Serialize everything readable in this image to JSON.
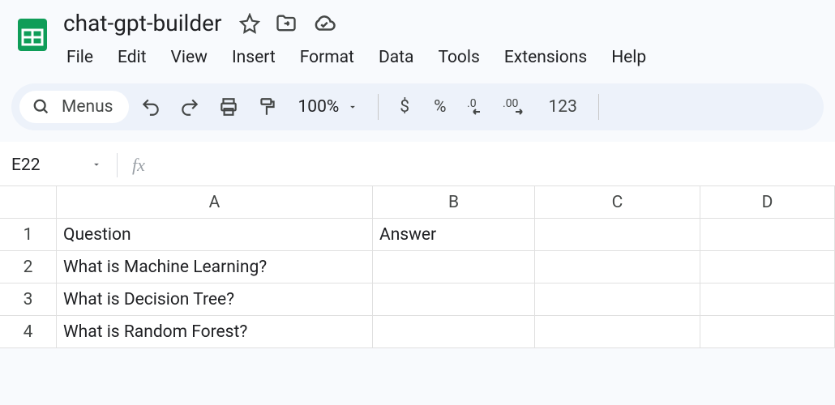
{
  "doc": {
    "title": "chat-gpt-builder"
  },
  "menus": [
    "File",
    "Edit",
    "View",
    "Insert",
    "Format",
    "Data",
    "Tools",
    "Extensions",
    "Help"
  ],
  "toolbar": {
    "menus_label": "Menus",
    "zoom": "100%",
    "currency": "$",
    "percent": "%",
    "fmt123": "123"
  },
  "namebox": {
    "ref": "E22",
    "fx": "fx"
  },
  "columns": [
    "A",
    "B",
    "C",
    "D"
  ],
  "rows": [
    {
      "n": "1",
      "cells": [
        "Question",
        "Answer",
        "",
        ""
      ]
    },
    {
      "n": "2",
      "cells": [
        "What is Machine Learning?",
        "",
        "",
        ""
      ]
    },
    {
      "n": "3",
      "cells": [
        "What is Decision Tree?",
        "",
        "",
        ""
      ]
    },
    {
      "n": "4",
      "cells": [
        "What is Random Forest?",
        "",
        "",
        ""
      ]
    }
  ]
}
